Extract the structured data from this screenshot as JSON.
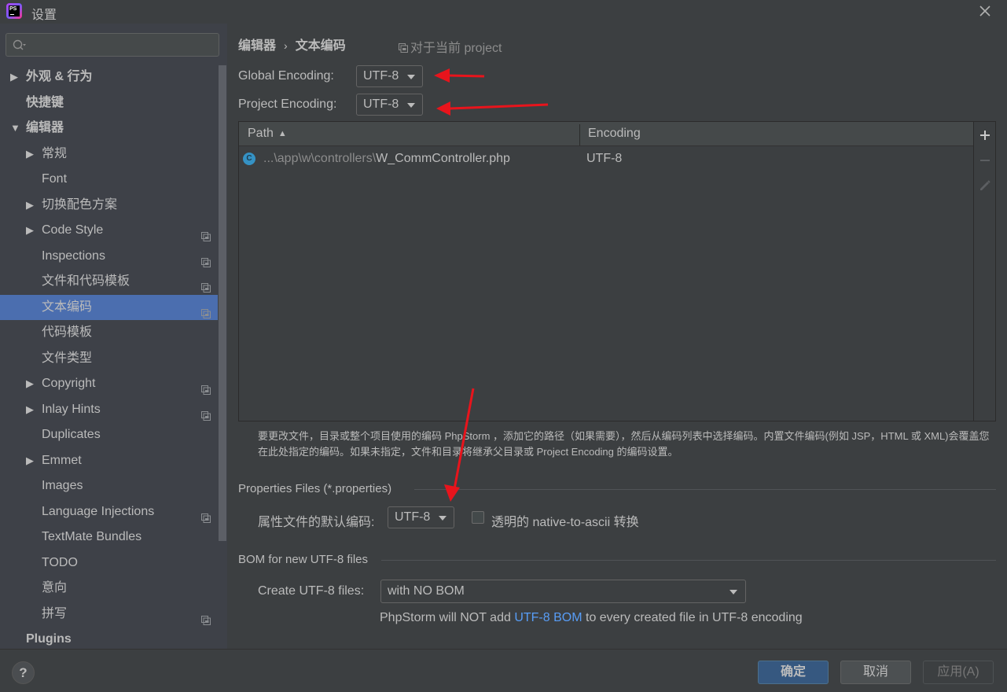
{
  "window": {
    "title": "设置",
    "app_logo_text": "PS"
  },
  "sidebar": {
    "search_placeholder": "",
    "items": [
      {
        "label": "外观 & 行为",
        "level": 0,
        "bold": true,
        "expandable": true,
        "expanded": false,
        "project_icon": false
      },
      {
        "label": "快捷键",
        "level": 0,
        "bold": true,
        "expandable": false,
        "project_icon": false
      },
      {
        "label": "编辑器",
        "level": 0,
        "bold": true,
        "expandable": true,
        "expanded": true,
        "project_icon": false
      },
      {
        "label": "常规",
        "level": 1,
        "expandable": true,
        "project_icon": false
      },
      {
        "label": "Font",
        "level": 1,
        "expandable": false,
        "project_icon": false
      },
      {
        "label": "切换配色方案",
        "level": 1,
        "expandable": true,
        "project_icon": false
      },
      {
        "label": "Code Style",
        "level": 1,
        "expandable": true,
        "project_icon": true
      },
      {
        "label": "Inspections",
        "level": 1,
        "expandable": false,
        "project_icon": true
      },
      {
        "label": "文件和代码模板",
        "level": 1,
        "expandable": false,
        "project_icon": true
      },
      {
        "label": "文本编码",
        "level": 1,
        "expandable": false,
        "project_icon": true,
        "selected": true
      },
      {
        "label": "代码模板",
        "level": 1,
        "expandable": false,
        "project_icon": false
      },
      {
        "label": "文件类型",
        "level": 1,
        "expandable": false,
        "project_icon": false
      },
      {
        "label": "Copyright",
        "level": 1,
        "expandable": true,
        "project_icon": true
      },
      {
        "label": "Inlay Hints",
        "level": 1,
        "expandable": true,
        "project_icon": true
      },
      {
        "label": "Duplicates",
        "level": 1,
        "expandable": false,
        "project_icon": false
      },
      {
        "label": "Emmet",
        "level": 1,
        "expandable": true,
        "project_icon": false
      },
      {
        "label": "Images",
        "level": 1,
        "expandable": false,
        "project_icon": false
      },
      {
        "label": "Language Injections",
        "level": 1,
        "expandable": false,
        "project_icon": true
      },
      {
        "label": "TextMate Bundles",
        "level": 1,
        "expandable": false,
        "project_icon": false
      },
      {
        "label": "TODO",
        "level": 1,
        "expandable": false,
        "project_icon": false
      },
      {
        "label": "意向",
        "level": 1,
        "expandable": false,
        "project_icon": false
      },
      {
        "label": "拼写",
        "level": 1,
        "expandable": false,
        "project_icon": true
      },
      {
        "label": "Plugins",
        "level": 0,
        "bold": true,
        "expandable": false,
        "project_icon": false
      }
    ]
  },
  "main": {
    "breadcrumb": [
      "编辑器",
      "文本编码"
    ],
    "breadcrumb_separator": "›",
    "for_project_label": "对于当前 project",
    "global_encoding": {
      "label": "Global Encoding:",
      "value": "UTF-8"
    },
    "project_encoding": {
      "label": "Project Encoding:",
      "value": "UTF-8"
    },
    "table": {
      "columns": [
        {
          "label": "Path",
          "sort": "▲"
        },
        {
          "label": "Encoding"
        }
      ],
      "rows": [
        {
          "icon": "C",
          "path_prefix": "...\\app\\w\\controllers\\",
          "file_name": "W_CommController.php",
          "encoding": "UTF-8"
        }
      ],
      "toolbar": {
        "add": "+",
        "remove": "−",
        "edit": "edit"
      }
    },
    "hint_text": "要更改文件，目录或整个项目使用的编码 PhpStorm ，添加它的路径（如果需要），然后从编码列表中选择编码。内置文件编码(例如 JSP，HTML 或 XML)会覆盖您在此处指定的编码。如果未指定，文件和目录将继承父目录或 Project Encoding 的编码设置。",
    "properties_section": {
      "title": "Properties Files (*.properties)",
      "default_encoding_label": "属性文件的默认编码:",
      "default_encoding_value": "UTF-8",
      "native_to_ascii_label": "透明的 native-to-ascii 转换",
      "native_to_ascii_checked": false
    },
    "bom_section": {
      "title": "BOM for new UTF-8 files",
      "create_label": "Create UTF-8 files:",
      "create_value": "with NO BOM",
      "desc_before": "PhpStorm will NOT add ",
      "desc_link": "UTF-8 BOM",
      "desc_after": " to every created file in UTF-8 encoding"
    }
  },
  "footer": {
    "help_label": "?",
    "ok_label": "确定",
    "cancel_label": "取消",
    "apply_label": "应用(A)"
  },
  "colors": {
    "selection": "#4b6eaf",
    "link": "#589df6",
    "annotation_arrow": "#e8141c",
    "primary_button": "#365880"
  }
}
